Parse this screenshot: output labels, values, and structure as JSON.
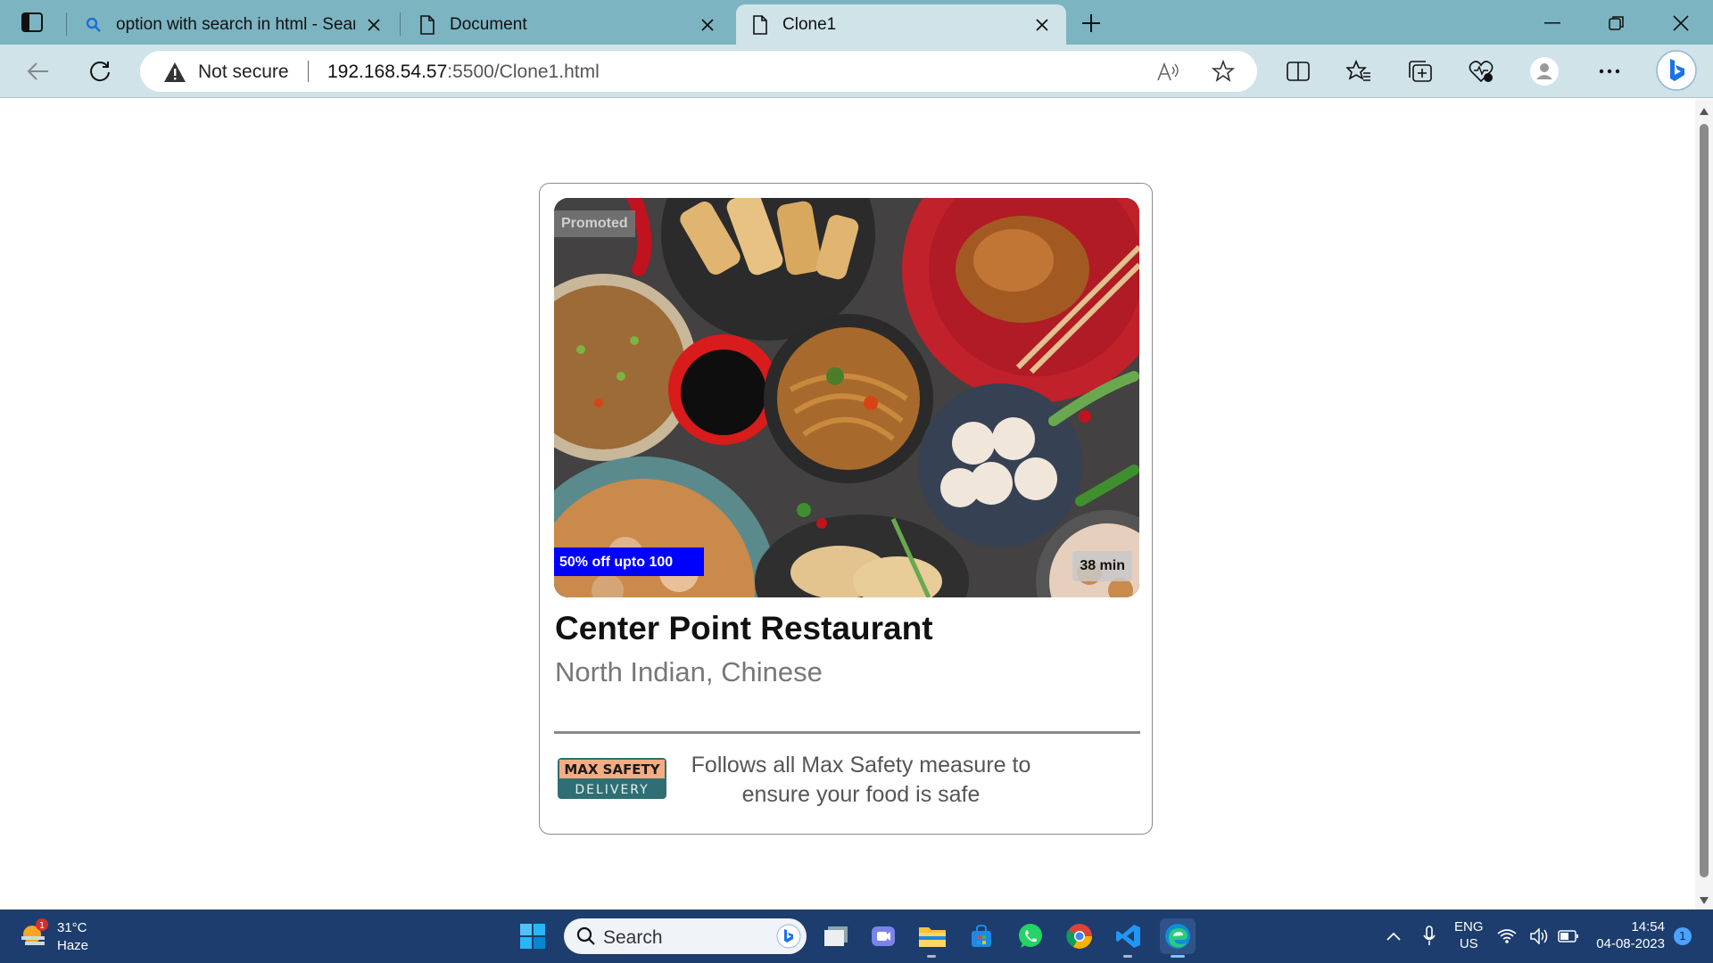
{
  "browser": {
    "tabs": [
      {
        "title": "option with search in html - Sear",
        "icon": "search-icon"
      },
      {
        "title": "Document",
        "icon": "page-icon"
      },
      {
        "title": "Clone1",
        "icon": "page-icon"
      }
    ],
    "address": {
      "security_label": "Not secure",
      "url_host": "192.168.54.57",
      "url_rest": ":5500/Clone1.html"
    }
  },
  "card": {
    "badge_promoted": "Promoted",
    "badge_offer": "50% off upto 100",
    "badge_time": "38 min",
    "restaurant_name": "Center Point Restaurant",
    "cuisines": "North Indian, Chinese",
    "safety_logo_line1": "MAX SAFETY",
    "safety_logo_line2": "DELIVERY",
    "safety_text": "Follows all Max Safety measure to ensure your food is safe",
    "offer_color": "#0000ff"
  },
  "taskbar": {
    "weather": {
      "temp": "31°C",
      "condition": "Haze",
      "badge": "1"
    },
    "search_placeholder": "Search",
    "language": {
      "line1": "ENG",
      "line2": "US"
    },
    "clock": {
      "time": "14:54",
      "date": "04-08-2023"
    },
    "notification_count": "1"
  }
}
